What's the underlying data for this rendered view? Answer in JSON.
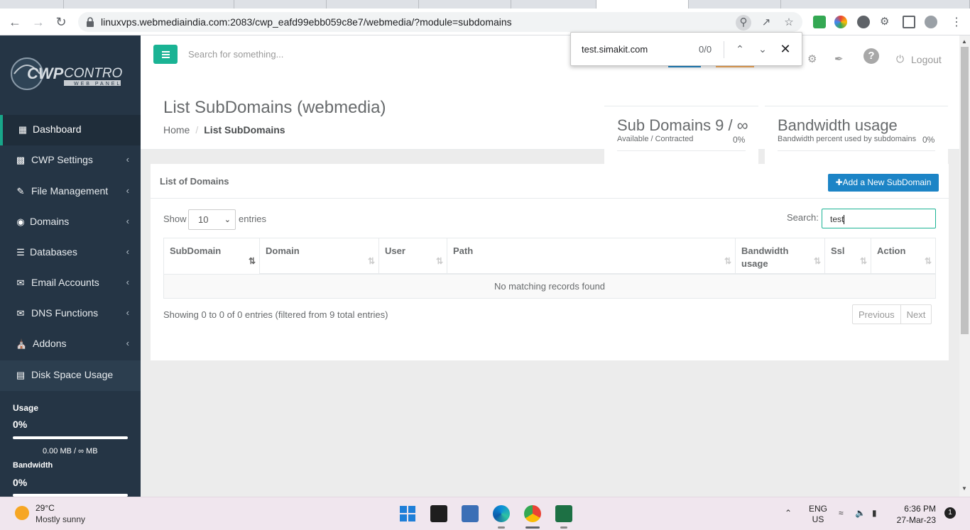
{
  "browser": {
    "url": "linuxvps.webmediaindia.com:2083/cwp_eafd99ebb059c8e7/webmedia/?module=subdomains",
    "find": {
      "query": "test.simakit.com",
      "count": "0/0"
    }
  },
  "brand": {
    "logo_text": "CWPCONTROL",
    "logo_sub": "WEB PANEL",
    "accent": "#1ab394",
    "button_blue": "#1c84c6",
    "sidebar_bg": "#253545"
  },
  "sidebar": {
    "items": [
      {
        "label": "Dashboard",
        "icon": "dashboard-icon",
        "active": true
      },
      {
        "label": "CWP Settings",
        "icon": "bar-chart-icon"
      },
      {
        "label": "File Management",
        "icon": "edit-icon"
      },
      {
        "label": "Domains",
        "icon": "globe-icon"
      },
      {
        "label": "Databases",
        "icon": "database-icon"
      },
      {
        "label": "Email Accounts",
        "icon": "envelope-icon"
      },
      {
        "label": "DNS Functions",
        "icon": "envelope-icon"
      },
      {
        "label": "Addons",
        "icon": "bank-icon"
      },
      {
        "label": "Disk Space Usage",
        "icon": "disk-icon"
      }
    ],
    "usage": {
      "label": "Usage",
      "percent": "0%",
      "detail": "0.00 MB / ∞ MB"
    },
    "bandwidth": {
      "label": "Bandwidth",
      "percent": "0%"
    }
  },
  "topnav": {
    "search_placeholder": "Search for something...",
    "logout": "Logout"
  },
  "page": {
    "title": "List SubDomains (webmedia)",
    "breadcrumb": {
      "home": "Home",
      "current": "List SubDomains"
    }
  },
  "stats": {
    "subdomains": {
      "title": "Sub Domains 9 / ∞",
      "caption": "Available / Contracted",
      "percent": "0%"
    },
    "bandwidth": {
      "title": "Bandwidth usage",
      "caption": "Bandwidth percent used by subdomains",
      "percent": "0%"
    }
  },
  "panel": {
    "title": "List of Domains",
    "add_button": "Add a New SubDomain",
    "show_label": "Show",
    "page_size": "10",
    "entries_label": "entries",
    "search_label": "Search:",
    "search_value": "test",
    "columns": [
      "SubDomain",
      "Domain",
      "User",
      "Path",
      "Bandwidth usage",
      "Ssl",
      "Action"
    ],
    "empty_text": "No matching records found",
    "info": "Showing 0 to 0 of 0 entries (filtered from 9 total entries)",
    "previous": "Previous",
    "next": "Next"
  },
  "taskbar": {
    "temp": "29°C",
    "condition": "Mostly sunny",
    "lang_1": "ENG",
    "lang_2": "US",
    "time": "6:36 PM",
    "date": "27-Mar-23",
    "notifications": "1"
  }
}
